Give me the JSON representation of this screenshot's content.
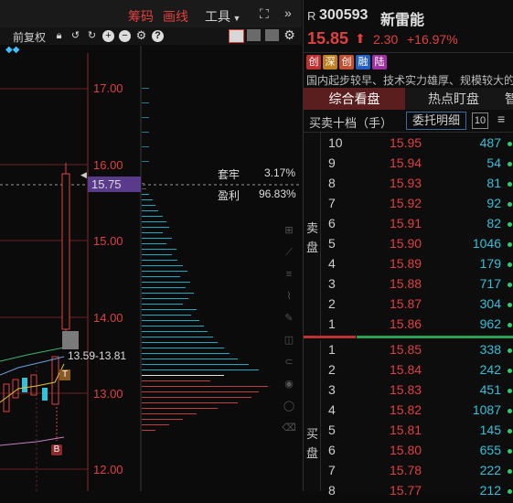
{
  "toolbar": {
    "tabs": [
      "筹码",
      "画线"
    ],
    "tools_label": "工具",
    "fuquan_label": "前复权"
  },
  "chart": {
    "price_ticks": [
      "17.00",
      "16.00",
      "15.00",
      "14.00",
      "13.00",
      "12.00"
    ],
    "current_price_tag": "15.75",
    "trapped_label": "套牢",
    "trapped_value": "3.17%",
    "profit_label": "盈利",
    "profit_value": "96.83%",
    "range_label": "13.59-13.81",
    "marker_T": "T",
    "marker_B": "B"
  },
  "quote": {
    "prefix": "R",
    "code": "300593",
    "name": "新雷能",
    "price": "15.85",
    "change": "2.30",
    "change_pct": "+16.97%",
    "badges": [
      "创",
      "深",
      "创",
      "融",
      "陆"
    ],
    "intro": "国内起步较早、技术实力雄厚、规模较大的",
    "tabs": [
      "综合看盘",
      "热点盯盘",
      "智"
    ],
    "orderbook_title": "买卖十档（手）",
    "entrust_label": "委托明细",
    "ten_label": "10",
    "sell_label": [
      "卖",
      "盘"
    ],
    "buy_label": [
      "买",
      "盘"
    ]
  },
  "asks": [
    {
      "lvl": "10",
      "price": "15.95",
      "vol": "487"
    },
    {
      "lvl": "9",
      "price": "15.94",
      "vol": "54"
    },
    {
      "lvl": "8",
      "price": "15.93",
      "vol": "81"
    },
    {
      "lvl": "7",
      "price": "15.92",
      "vol": "92"
    },
    {
      "lvl": "6",
      "price": "15.91",
      "vol": "82"
    },
    {
      "lvl": "5",
      "price": "15.90",
      "vol": "1046"
    },
    {
      "lvl": "4",
      "price": "15.89",
      "vol": "179"
    },
    {
      "lvl": "3",
      "price": "15.88",
      "vol": "717"
    },
    {
      "lvl": "2",
      "price": "15.87",
      "vol": "304"
    },
    {
      "lvl": "1",
      "price": "15.86",
      "vol": "962"
    }
  ],
  "bids": [
    {
      "lvl": "1",
      "price": "15.85",
      "vol": "338"
    },
    {
      "lvl": "2",
      "price": "15.84",
      "vol": "242"
    },
    {
      "lvl": "3",
      "price": "15.83",
      "vol": "451"
    },
    {
      "lvl": "4",
      "price": "15.82",
      "vol": "1087"
    },
    {
      "lvl": "5",
      "price": "15.81",
      "vol": "145"
    },
    {
      "lvl": "6",
      "price": "15.80",
      "vol": "655"
    },
    {
      "lvl": "7",
      "price": "15.78",
      "vol": "222"
    },
    {
      "lvl": "8",
      "price": "15.77",
      "vol": "212"
    }
  ]
}
